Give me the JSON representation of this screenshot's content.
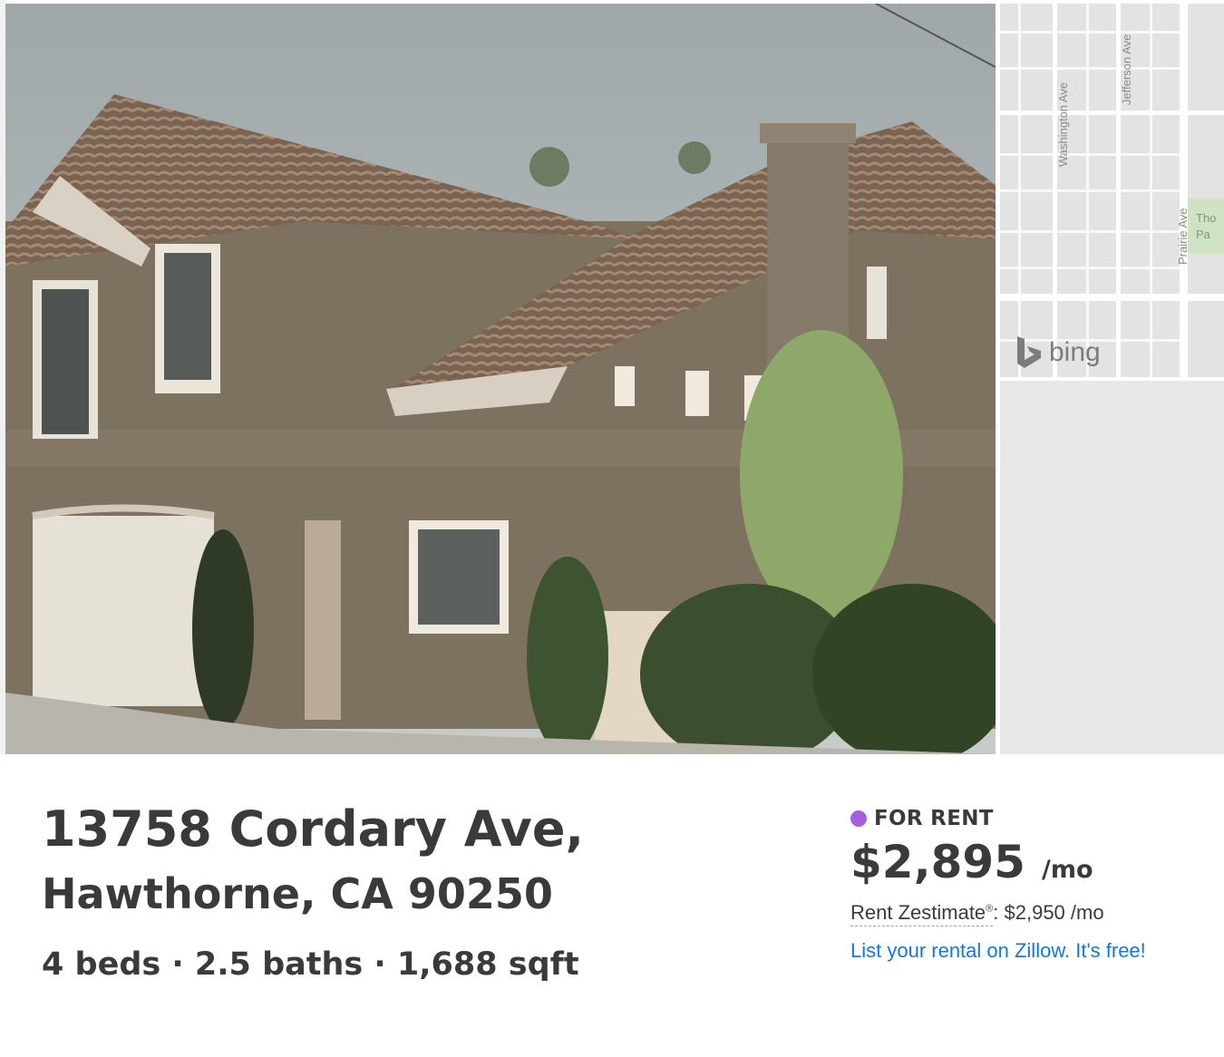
{
  "map": {
    "streets": [
      "Washington Ave",
      "Jefferson Ave",
      "Prairie Ave"
    ],
    "park_label_lines": [
      "Tho",
      "Pa"
    ],
    "provider": "bing"
  },
  "listing": {
    "address_line1": "13758 Cordary Ave,",
    "address_line2": "Hawthorne, CA 90250",
    "facts": "4 beds · 2.5 baths · 1,688 sqft",
    "status": "FOR RENT",
    "status_color": "#a65ee1",
    "price": "$2,895",
    "price_unit": "/mo",
    "zestimate_label": "Rent Zestimate",
    "zestimate_mark": "®",
    "zestimate_value": ": $2,950 /mo",
    "list_link": "List your rental on Zillow. It's free!"
  }
}
